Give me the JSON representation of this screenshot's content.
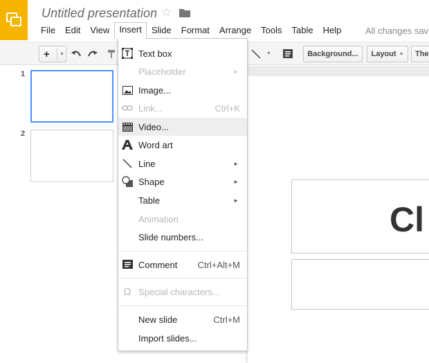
{
  "app": {
    "title": "Untitled presentation",
    "saved_status": "All changes sav"
  },
  "menubar": {
    "items": [
      "File",
      "Edit",
      "View",
      "Insert",
      "Slide",
      "Format",
      "Arrange",
      "Tools",
      "Table",
      "Help"
    ],
    "active": "Insert"
  },
  "toolbar": {
    "background_label": "Background...",
    "layout_label": "Layout",
    "theme_label": "The"
  },
  "filmstrip": {
    "slide_numbers": [
      "1",
      "2"
    ],
    "selected": "1"
  },
  "slide": {
    "title_fragment": "Cl"
  },
  "insert_menu": {
    "items": [
      {
        "label": "Text box",
        "icon": "text-box-icon",
        "disabled": false
      },
      {
        "label": "Placeholder",
        "icon": "",
        "disabled": true,
        "submenu": true
      },
      {
        "label": "Image...",
        "icon": "image-icon",
        "disabled": false
      },
      {
        "label": "Link...",
        "icon": "link-icon",
        "disabled": true,
        "shortcut": "Ctrl+K"
      },
      {
        "label": "Video...",
        "icon": "video-icon",
        "disabled": false,
        "hover": true
      },
      {
        "label": "Word art",
        "icon": "word-art-icon",
        "disabled": false
      },
      {
        "label": "Line",
        "icon": "line-icon",
        "disabled": false,
        "submenu": true
      },
      {
        "label": "Shape",
        "icon": "shape-icon",
        "disabled": false,
        "submenu": true
      },
      {
        "label": "Table",
        "icon": "",
        "disabled": false,
        "submenu": true
      },
      {
        "label": "Animation",
        "icon": "",
        "disabled": true
      },
      {
        "label": "Slide numbers...",
        "icon": "",
        "disabled": false
      },
      {
        "label": "Comment",
        "icon": "comment-icon",
        "disabled": false,
        "shortcut": "Ctrl+Alt+M"
      },
      {
        "label": "Special characters...",
        "icon": "omega-icon",
        "disabled": true
      },
      {
        "label": "New slide",
        "icon": "",
        "disabled": false,
        "shortcut": "Ctrl+M"
      },
      {
        "label": "Import slides...",
        "icon": "",
        "disabled": false
      }
    ]
  },
  "colors": {
    "brand": "#f4b400",
    "selection": "#4d90fe",
    "hover": "#eeeeee",
    "disabled_text": "#b8b8b8"
  }
}
